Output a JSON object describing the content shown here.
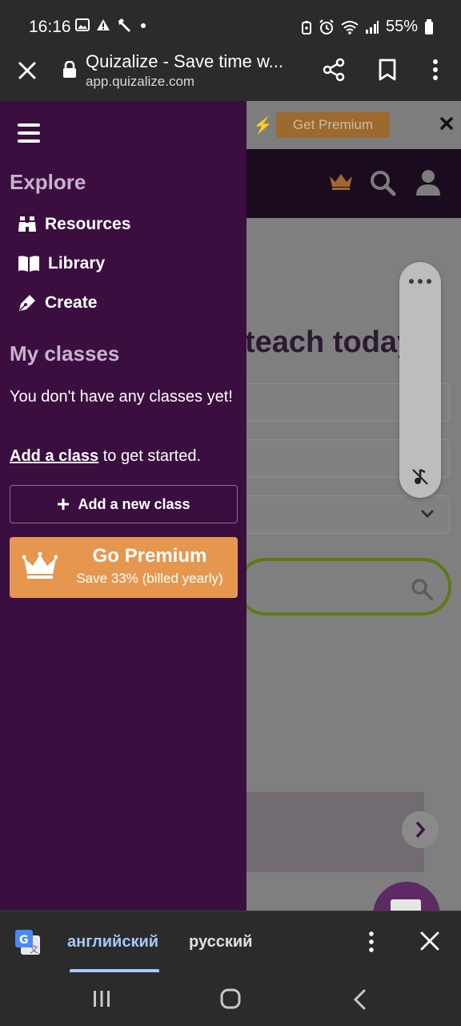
{
  "status_bar": {
    "time": "16:16",
    "battery": "55%",
    "icons": [
      "image-icon",
      "warning-icon",
      "wrench-icon",
      "dot-icon",
      "battery-saver-icon",
      "alarm-icon",
      "wifi-icon",
      "signal-icon",
      "battery-icon"
    ]
  },
  "browser": {
    "title": "Quizalize - Save time w...",
    "url": "app.quizalize.com"
  },
  "page": {
    "promo_button": "Get Premium",
    "hero_text": "teach today"
  },
  "drawer": {
    "explore_title": "Explore",
    "nav_items": [
      {
        "label": "Resources",
        "icon": "binoculars-icon"
      },
      {
        "label": "Library",
        "icon": "book-icon"
      },
      {
        "label": "Create",
        "icon": "pen-icon"
      }
    ],
    "classes_title": "My classes",
    "no_classes_text": "You don't have any classes yet!",
    "add_class_link": "Add a class",
    "add_class_suffix": " to get started.",
    "add_new_class_button": "Add a new class",
    "premium": {
      "title": "Go Premium",
      "subtitle": "Save 33% (billed yearly)"
    }
  },
  "translate_bar": {
    "source_lang": "английский",
    "target_lang": "русский"
  },
  "colors": {
    "drawer_bg": "#3a0f40",
    "premium_orange": "#e6974f",
    "translate_accent": "#a8c7fa"
  }
}
